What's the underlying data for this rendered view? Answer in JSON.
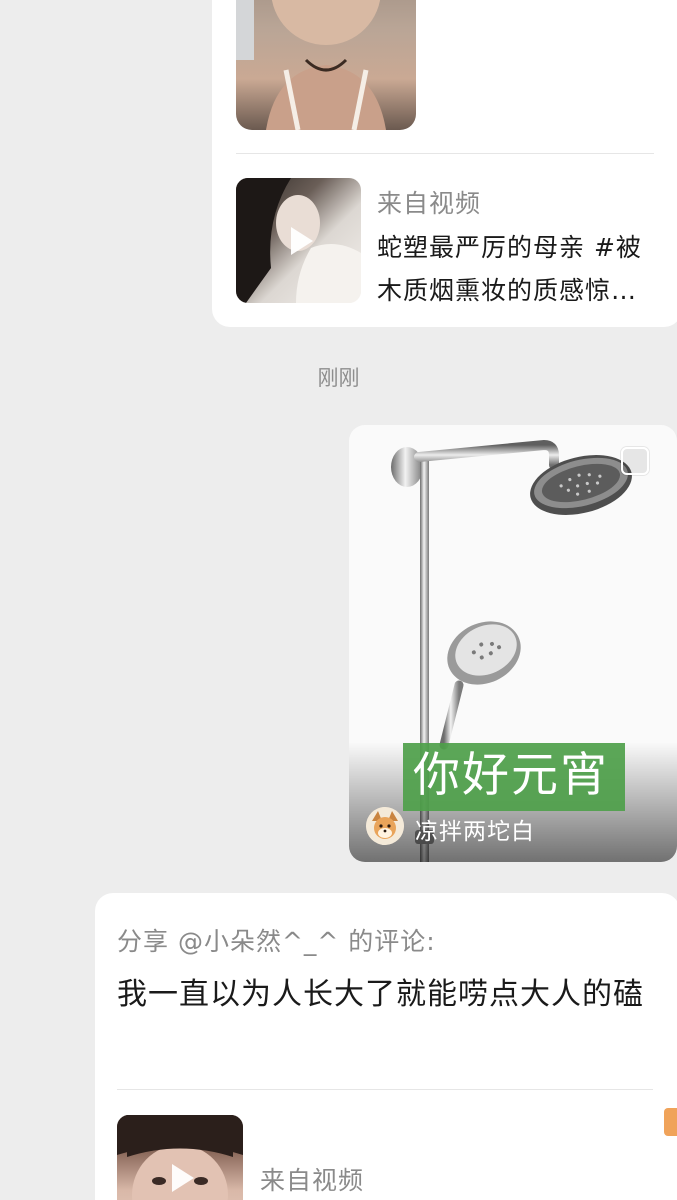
{
  "top_card": {
    "video_from": "来自视频",
    "video_title_line1": "蛇塑最严厉的母亲 #被",
    "video_title_line2": "木质烟熏妆的质感惊…"
  },
  "timestamp": "刚刚",
  "image_card": {
    "caption": "你好元宵",
    "author": "凉拌两坨白"
  },
  "comment_card": {
    "share_line": "分享 @小朵然^_^ 的评论:",
    "comment": "我一直以为人长大了就能唠点大人的磕",
    "video_from": "来自视频"
  },
  "icons": [
    "play-icon",
    "select-checkbox-icon",
    "author-avatar",
    "side-tag"
  ],
  "colors": {
    "background": "#ededed",
    "card": "#ffffff",
    "caption_green": "#4ea04a",
    "muted_text": "#8a8a8a"
  }
}
